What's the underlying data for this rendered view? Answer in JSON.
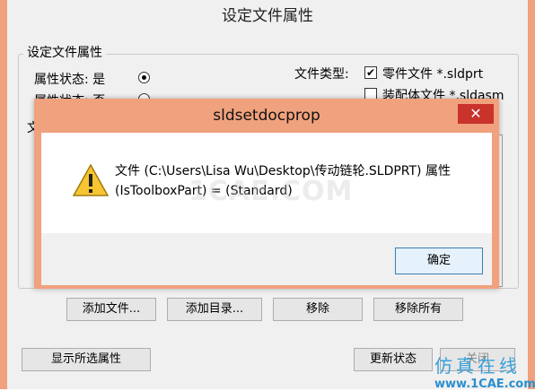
{
  "window": {
    "title": "设定文件属性"
  },
  "group": {
    "title": "设定文件属性"
  },
  "props": {
    "status_yes": "属性状态: 是",
    "status_no": "属性状态: 否",
    "file_type_label": "文件类型:",
    "part_label": "零件文件 *.sldprt",
    "part_checked": true,
    "assembly_label": "装配体文件 *.sldasm",
    "assembly_checked": false,
    "list_label": "文"
  },
  "buttons": {
    "add_file": "添加文件...",
    "add_dir": "添加目录...",
    "remove": "移除",
    "remove_all": "移除所有",
    "show_selected": "显示所选属性",
    "update_status": "更新状态",
    "close": "关闭"
  },
  "dialog": {
    "title": "sldsetdocprop",
    "close_glyph": "✕",
    "message_line1": "文件 (C:\\Users\\Lisa Wu\\Desktop\\传动链轮.SLDPRT) 属性",
    "message_line2": "(IsToolboxPart) = (Standard)",
    "ok_label": "确定"
  },
  "watermark": "1CAE.COM",
  "brand": {
    "cn": "仿真在线",
    "url": "www.1CAE.com"
  },
  "colors": {
    "accent": "#f0a17d",
    "close_red": "#c9332c",
    "brand_blue": "#2a8fce"
  }
}
